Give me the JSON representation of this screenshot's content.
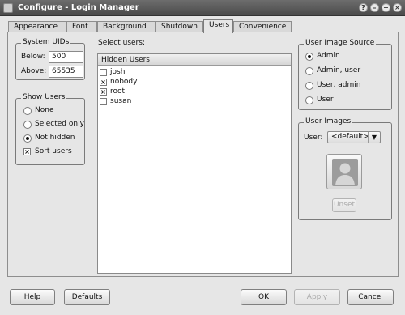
{
  "window": {
    "title": "Configure - Login Manager",
    "controls": [
      "help-icon",
      "minimize-icon",
      "maximize-icon",
      "close-icon"
    ]
  },
  "tabs": [
    {
      "label": "Appearance",
      "active": false
    },
    {
      "label": "Font",
      "active": false
    },
    {
      "label": "Background",
      "active": false
    },
    {
      "label": "Shutdown",
      "active": false
    },
    {
      "label": "Users",
      "active": true
    },
    {
      "label": "Convenience",
      "active": false
    }
  ],
  "system_uids": {
    "title": "System UIDs",
    "below_label": "Below:",
    "below_value": "500",
    "above_label": "Above:",
    "above_value": "65535"
  },
  "show_users": {
    "title": "Show Users",
    "options": [
      {
        "label": "None",
        "selected": false
      },
      {
        "label": "Selected only",
        "selected": false
      },
      {
        "label": "Not hidden",
        "selected": true
      }
    ],
    "sort_users": {
      "label": "Sort users",
      "checked": true
    }
  },
  "select_users": {
    "label": "Select users:",
    "header": "Hidden Users",
    "users": [
      {
        "name": "josh",
        "checked": false
      },
      {
        "name": "nobody",
        "checked": true
      },
      {
        "name": "root",
        "checked": true
      },
      {
        "name": "susan",
        "checked": false
      }
    ]
  },
  "user_image_source": {
    "title": "User Image Source",
    "options": [
      {
        "label": "Admin",
        "selected": true
      },
      {
        "label": "Admin, user",
        "selected": false
      },
      {
        "label": "User, admin",
        "selected": false
      },
      {
        "label": "User",
        "selected": false
      }
    ]
  },
  "user_images": {
    "title": "User Images",
    "user_label": "User:",
    "user_value": "<default>",
    "unset_label": "Unset",
    "image_icon": "user-silhouette-icon"
  },
  "buttons": {
    "help": "Help",
    "defaults": "Defaults",
    "ok": "OK",
    "apply": "Apply",
    "cancel": "Cancel"
  }
}
